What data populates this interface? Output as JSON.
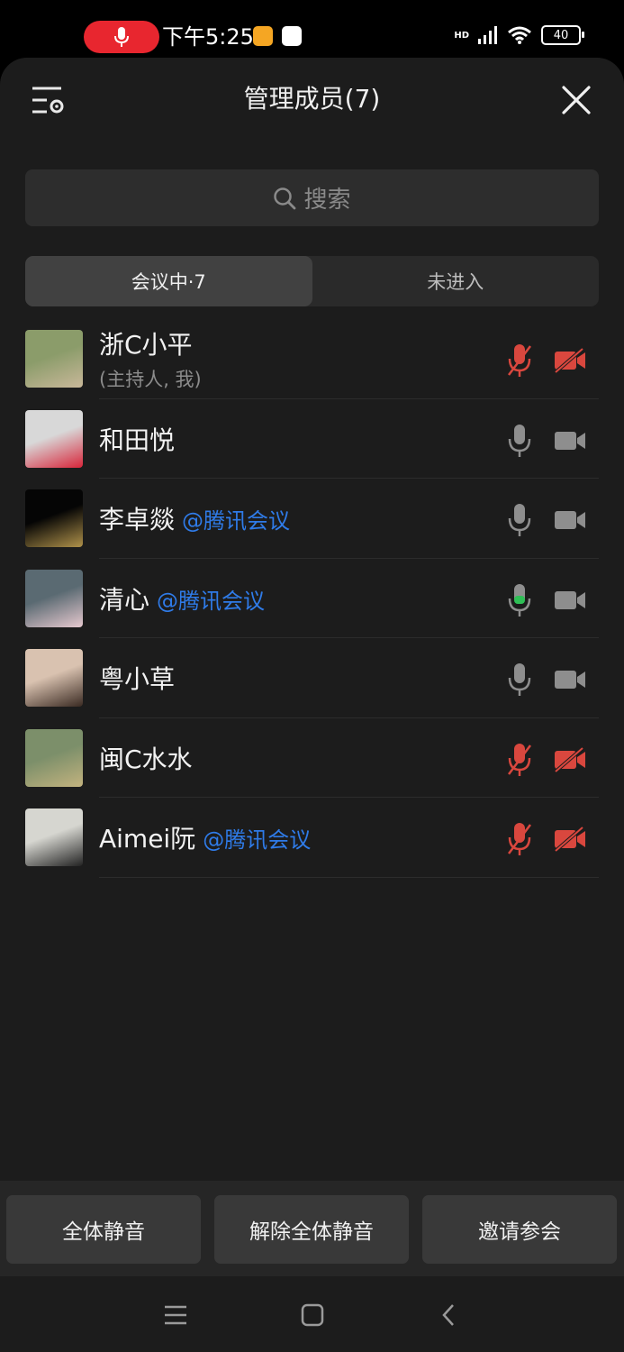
{
  "status_bar": {
    "time": "下午5:25",
    "battery": "40",
    "network": "HD"
  },
  "header": {
    "title": "管理成员(7)"
  },
  "search": {
    "placeholder": "搜索"
  },
  "tabs": [
    {
      "label": "会议中·7",
      "active": true
    },
    {
      "label": "未进入",
      "active": false
    }
  ],
  "members": [
    {
      "name": "浙C小平",
      "sub": "(主持人, 我)",
      "tag": "",
      "mic": "muted",
      "camera": "off",
      "avatar_colors": [
        "#8b9c6a",
        "#c9b89a"
      ]
    },
    {
      "name": "和田悦",
      "sub": "",
      "tag": "",
      "mic": "on",
      "camera": "on",
      "avatar_colors": [
        "#d8d8d8",
        "#d8253a"
      ]
    },
    {
      "name": "李卓燚",
      "sub": "",
      "tag": "@腾讯会议",
      "mic": "on",
      "camera": "on",
      "avatar_colors": [
        "#050505",
        "#b0924a"
      ]
    },
    {
      "name": "清心",
      "sub": "",
      "tag": "@腾讯会议",
      "mic": "speaking",
      "camera": "on",
      "avatar_colors": [
        "#5a6a72",
        "#e7c9cf"
      ]
    },
    {
      "name": "粤小草",
      "sub": "",
      "tag": "",
      "mic": "on",
      "camera": "on",
      "avatar_colors": [
        "#d9c2b0",
        "#3a2a22"
      ]
    },
    {
      "name": "闽C水水",
      "sub": "",
      "tag": "",
      "mic": "muted",
      "camera": "off",
      "avatar_colors": [
        "#7c8f6a",
        "#c3b37f"
      ]
    },
    {
      "name": "Aimei阮",
      "sub": "",
      "tag": "@腾讯会议",
      "mic": "muted",
      "camera": "off",
      "avatar_colors": [
        "#d6d6d0",
        "#222222"
      ]
    }
  ],
  "bottom_actions": {
    "mute_all": "全体静音",
    "unmute_all": "解除全体静音",
    "invite": "邀请参会"
  },
  "colors": {
    "muted_red": "#d9473e",
    "icon_gray": "#8e8e8e",
    "speaking_green": "#2fbf56",
    "link_blue": "#2f7be8",
    "rec_red": "#e8262f"
  }
}
